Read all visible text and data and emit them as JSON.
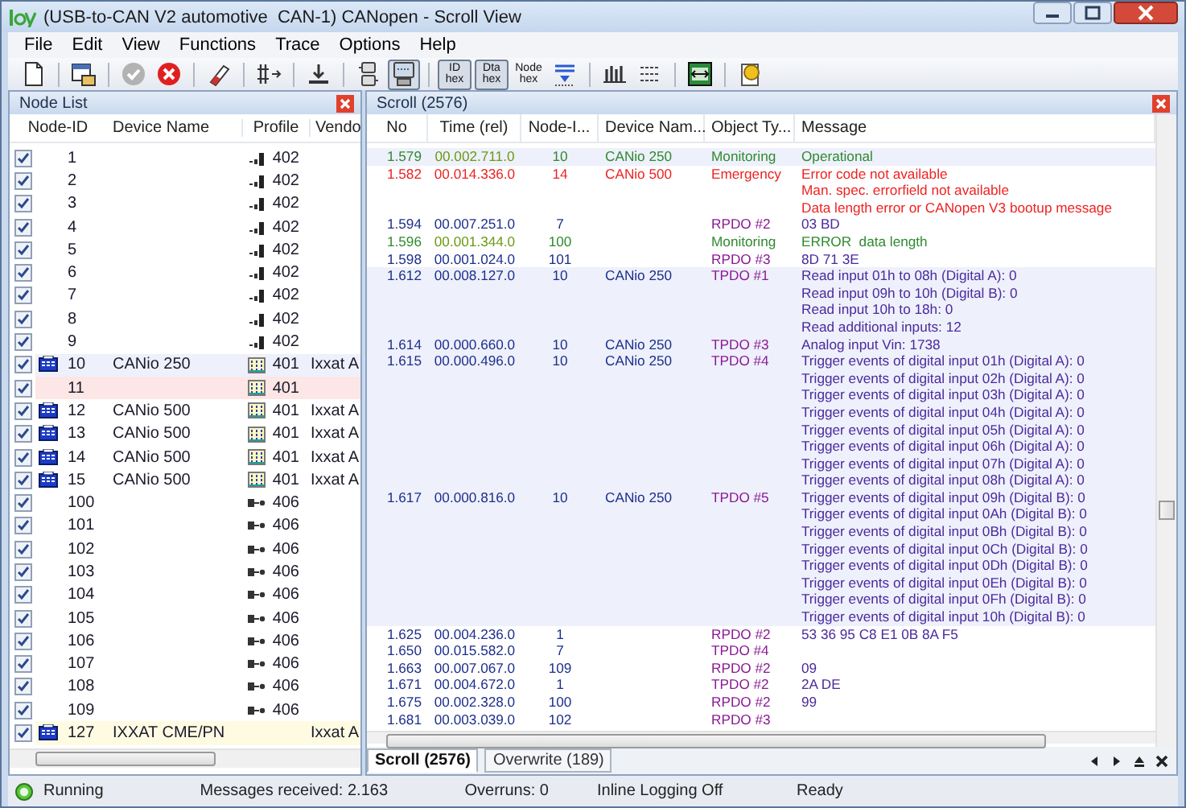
{
  "window": {
    "title": "(USB-to-CAN V2 automotive  CAN-1) CANopen - Scroll View"
  },
  "menu": [
    "File",
    "Edit",
    "View",
    "Functions",
    "Trace",
    "Options",
    "Help"
  ],
  "toolbar": {
    "groups": [
      [
        {
          "kind": "new",
          "pressed": false,
          "disabled": false
        }
      ],
      [
        {
          "kind": "export",
          "pressed": false,
          "disabled": false
        }
      ],
      [
        {
          "kind": "apply",
          "pressed": false,
          "disabled": true
        },
        {
          "kind": "stop",
          "pressed": false,
          "disabled": false
        }
      ],
      [
        {
          "kind": "erase",
          "pressed": false,
          "disabled": false
        }
      ],
      [
        {
          "kind": "filter",
          "pressed": false,
          "disabled": false
        }
      ],
      [
        {
          "kind": "download",
          "pressed": false,
          "disabled": false
        }
      ],
      [
        {
          "kind": "devices",
          "pressed": false,
          "disabled": false
        },
        {
          "kind": "monitor",
          "pressed": true,
          "disabled": false
        }
      ],
      [
        {
          "kind": "text",
          "lines": [
            "ID",
            "hex"
          ],
          "pressed": true
        },
        {
          "kind": "text",
          "lines": [
            "Dta",
            "hex"
          ],
          "pressed": true
        },
        {
          "kind": "text",
          "lines": [
            "Node",
            "hex"
          ],
          "pressed": false
        },
        {
          "kind": "level",
          "pressed": false,
          "disabled": false
        }
      ],
      [
        {
          "kind": "signal",
          "pressed": false,
          "disabled": false
        },
        {
          "kind": "bits",
          "pressed": false,
          "disabled": false
        }
      ],
      [
        {
          "kind": "capture",
          "pressed": false,
          "disabled": false
        }
      ],
      [
        {
          "kind": "help",
          "pressed": false,
          "disabled": false
        }
      ]
    ]
  },
  "node_list": {
    "title": "Node List",
    "columns": [
      "Node-ID",
      "Device Name",
      "Profile",
      "Vendo"
    ],
    "rows": [
      {
        "checked": true,
        "eds": false,
        "node_id": "1",
        "kind": "drive",
        "profile": "402"
      },
      {
        "checked": true,
        "eds": false,
        "node_id": "2",
        "kind": "drive",
        "profile": "402"
      },
      {
        "checked": true,
        "eds": false,
        "node_id": "3",
        "kind": "drive",
        "profile": "402"
      },
      {
        "checked": true,
        "eds": false,
        "node_id": "4",
        "kind": "drive",
        "profile": "402"
      },
      {
        "checked": true,
        "eds": false,
        "node_id": "5",
        "kind": "drive",
        "profile": "402"
      },
      {
        "checked": true,
        "eds": false,
        "node_id": "6",
        "kind": "drive",
        "profile": "402"
      },
      {
        "checked": true,
        "eds": false,
        "node_id": "7",
        "kind": "drive",
        "profile": "402"
      },
      {
        "checked": true,
        "eds": false,
        "node_id": "8",
        "kind": "drive",
        "profile": "402"
      },
      {
        "checked": true,
        "eds": false,
        "node_id": "9",
        "kind": "drive",
        "profile": "402"
      },
      {
        "checked": true,
        "eds": true,
        "node_id": "10",
        "device": "CANio 250",
        "kind": "io",
        "profile": "401",
        "vendor": "Ixxat A",
        "color": "#eef0fb"
      },
      {
        "checked": true,
        "eds": false,
        "node_id": "11",
        "kind": "io",
        "profile": "401",
        "color": "#fde6e6"
      },
      {
        "checked": true,
        "eds": true,
        "node_id": "12",
        "device": "CANio 500",
        "kind": "io",
        "profile": "401",
        "vendor": "Ixxat A"
      },
      {
        "checked": true,
        "eds": true,
        "node_id": "13",
        "device": "CANio 500",
        "kind": "io",
        "profile": "401",
        "vendor": "Ixxat A"
      },
      {
        "checked": true,
        "eds": true,
        "node_id": "14",
        "device": "CANio 500",
        "kind": "io",
        "profile": "401",
        "vendor": "Ixxat A"
      },
      {
        "checked": true,
        "eds": true,
        "node_id": "15",
        "device": "CANio 500",
        "kind": "io",
        "profile": "401",
        "vendor": "Ixxat A"
      },
      {
        "checked": true,
        "eds": false,
        "node_id": "100",
        "kind": "encoder",
        "profile": "406"
      },
      {
        "checked": true,
        "eds": false,
        "node_id": "101",
        "kind": "encoder",
        "profile": "406"
      },
      {
        "checked": true,
        "eds": false,
        "node_id": "102",
        "kind": "encoder",
        "profile": "406"
      },
      {
        "checked": true,
        "eds": false,
        "node_id": "103",
        "kind": "encoder",
        "profile": "406"
      },
      {
        "checked": true,
        "eds": false,
        "node_id": "104",
        "kind": "encoder",
        "profile": "406"
      },
      {
        "checked": true,
        "eds": false,
        "node_id": "105",
        "kind": "encoder",
        "profile": "406"
      },
      {
        "checked": true,
        "eds": false,
        "node_id": "106",
        "kind": "encoder",
        "profile": "406"
      },
      {
        "checked": true,
        "eds": false,
        "node_id": "107",
        "kind": "encoder",
        "profile": "406"
      },
      {
        "checked": true,
        "eds": false,
        "node_id": "108",
        "kind": "encoder",
        "profile": "406"
      },
      {
        "checked": true,
        "eds": false,
        "node_id": "109",
        "kind": "encoder",
        "profile": "406"
      },
      {
        "checked": true,
        "eds": true,
        "node_id": "127",
        "device": "IXXAT CME/PN",
        "kind": "gateway",
        "vendor": "Ixxat A",
        "color": "#fffbe3"
      }
    ]
  },
  "scroll_view": {
    "title": "Scroll (2576)",
    "columns": [
      "No",
      "Time (rel)",
      "Node-I...",
      "Device Nam...",
      "Object Ty...",
      "Message"
    ],
    "rows": [
      {
        "kind": "monitoring",
        "highlighted": true,
        "no": "1.579",
        "time": "00.002.711.0",
        "node": "10",
        "device": "CANio 250",
        "object": "Monitoring",
        "message": [
          "Operational"
        ]
      },
      {
        "kind": "emergency",
        "highlighted": false,
        "no": "1.582",
        "time": "00.014.336.0",
        "node": "14",
        "device": "CANio 500",
        "object": "Emergency",
        "message": [
          "Error code not available",
          "Man. spec. errorfield not available",
          "Data length error or CANopen V3 bootup message"
        ]
      },
      {
        "kind": "data",
        "highlighted": false,
        "no": "1.594",
        "time": "00.007.251.0",
        "node": "7",
        "object": "RPDO #2",
        "message": [
          "03 BD"
        ]
      },
      {
        "kind": "monitoring",
        "highlighted": false,
        "no": "1.596",
        "time": "00.001.344.0",
        "node": "100",
        "object": "Monitoring",
        "message": [
          "ERROR  data length"
        ]
      },
      {
        "kind": "data",
        "highlighted": false,
        "no": "1.598",
        "time": "00.001.024.0",
        "node": "101",
        "object": "RPDO #3",
        "message": [
          "8D 71 3E"
        ]
      },
      {
        "kind": "data",
        "highlighted": true,
        "no": "1.612",
        "time": "00.008.127.0",
        "node": "10",
        "device": "CANio 250",
        "object": "TPDO #1",
        "message": [
          "Read input 01h to 08h (Digital A): 0",
          "Read input 09h to 10h (Digital B): 0",
          "Read input 10h to 18h: 0",
          "Read additional inputs: 12"
        ]
      },
      {
        "kind": "data",
        "highlighted": true,
        "no": "1.614",
        "time": "00.000.660.0",
        "node": "10",
        "device": "CANio 250",
        "object": "TPDO #3",
        "message": [
          "Analog input Vin: 1738"
        ]
      },
      {
        "kind": "data",
        "highlighted": true,
        "no": "1.615",
        "time": "00.000.496.0",
        "node": "10",
        "device": "CANio 250",
        "object": "TPDO #4",
        "message": [
          "Trigger events of digital input 01h (Digital A): 0",
          "Trigger events of digital input 02h (Digital A): 0",
          "Trigger events of digital input 03h (Digital A): 0",
          "Trigger events of digital input 04h (Digital A): 0",
          "Trigger events of digital input 05h (Digital A): 0",
          "Trigger events of digital input 06h (Digital A): 0",
          "Trigger events of digital input 07h (Digital A): 0",
          "Trigger events of digital input 08h (Digital A): 0"
        ]
      },
      {
        "kind": "data",
        "highlighted": true,
        "no": "1.617",
        "time": "00.000.816.0",
        "node": "10",
        "device": "CANio 250",
        "object": "TPDO #5",
        "message": [
          "Trigger events of digital input 09h (Digital B): 0",
          "Trigger events of digital input 0Ah (Digital B): 0",
          "Trigger events of digital input 0Bh (Digital B): 0",
          "Trigger events of digital input 0Ch (Digital B): 0",
          "Trigger events of digital input 0Dh (Digital B): 0",
          "Trigger events of digital input 0Eh (Digital B): 0",
          "Trigger events of digital input 0Fh (Digital B): 0",
          "Trigger events of digital input 10h (Digital B): 0"
        ]
      },
      {
        "kind": "data",
        "highlighted": false,
        "no": "1.625",
        "time": "00.004.236.0",
        "node": "1",
        "object": "RPDO #2",
        "message": [
          "53 36 95 C8 E1 0B 8A F5"
        ]
      },
      {
        "kind": "data",
        "highlighted": false,
        "no": "1.650",
        "time": "00.015.582.0",
        "node": "7",
        "object": "TPDO #4"
      },
      {
        "kind": "data",
        "highlighted": false,
        "no": "1.663",
        "time": "00.007.067.0",
        "node": "109",
        "object": "RPDO #2",
        "message": [
          "09"
        ]
      },
      {
        "kind": "data",
        "highlighted": false,
        "no": "1.671",
        "time": "00.004.672.0",
        "node": "1",
        "object": "TPDO #2",
        "message": [
          "2A DE"
        ]
      },
      {
        "kind": "data",
        "highlighted": false,
        "no": "1.675",
        "time": "00.002.328.0",
        "node": "100",
        "object": "RPDO #2",
        "message": [
          "99"
        ]
      },
      {
        "kind": "data",
        "highlighted": false,
        "no": "1.681",
        "time": "00.003.039.0",
        "node": "102",
        "object": "RPDO #3"
      }
    ],
    "tabs": [
      {
        "label": "Scroll (2576)",
        "selected": true
      },
      {
        "label": "Overwrite (189)",
        "selected": false
      }
    ]
  },
  "status_bar": {
    "running": true,
    "state": "Running",
    "messages": "Messages received: 2.163",
    "overruns": "Overruns: 0",
    "logging": "Inline Logging Off",
    "ready": "Ready"
  }
}
